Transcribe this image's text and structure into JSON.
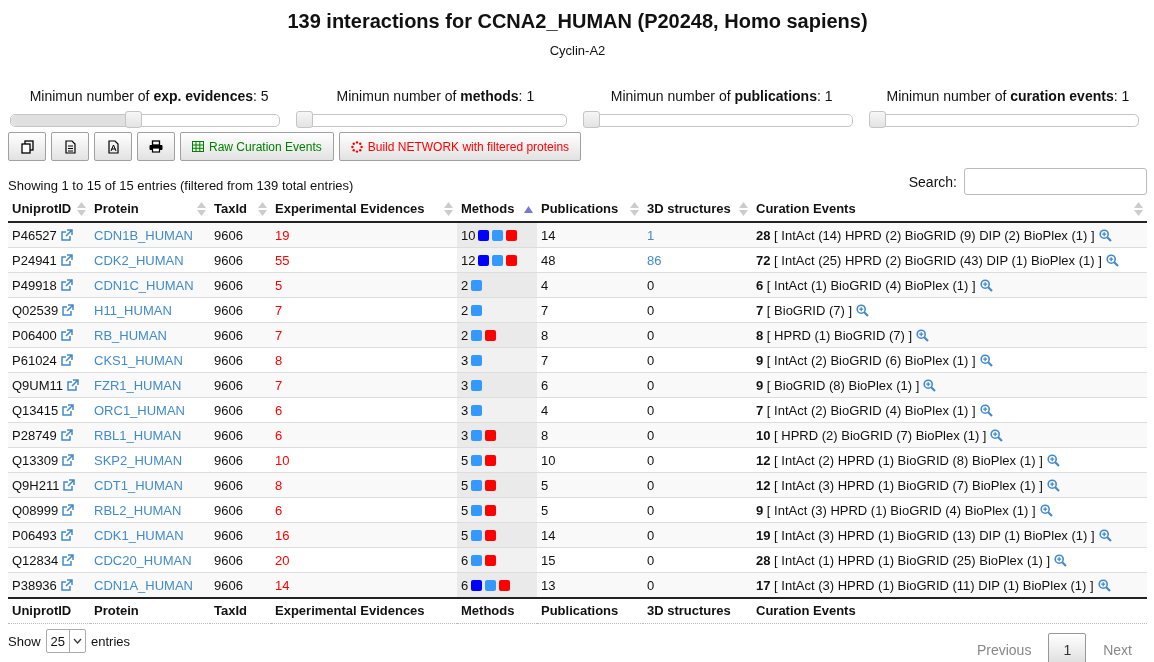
{
  "title": "139 interactions for CCNA2_HUMAN (P20248, Homo sapiens)",
  "subtitle": "Cyclin-A2",
  "sliders": [
    {
      "label": "Minimun number of **exp. evidences**: 5",
      "level": 0.43
    },
    {
      "label": "Minimun number of **methods**: 1",
      "level": 0
    },
    {
      "label": "Minimun number of **publications**: 1",
      "level": 0
    },
    {
      "label": "Minimun number of **curation events**: 1",
      "level": 0
    }
  ],
  "toolbar": [
    {
      "kind": "copy"
    },
    {
      "kind": "csv"
    },
    {
      "kind": "pdf"
    },
    {
      "kind": "print"
    },
    {
      "kind": "raw",
      "label": "Raw Curation Events"
    },
    {
      "kind": "network",
      "label": "Build NETWORK with filtered proteins"
    }
  ],
  "info": "Showing 1 to 15 of 15 entries (filtered from 139 total entries)",
  "search": {
    "label": "Search:"
  },
  "columns": [
    {
      "label": "UniprotID",
      "sorted": false
    },
    {
      "label": "Protein",
      "sorted": false
    },
    {
      "label": "TaxId",
      "sorted": false
    },
    {
      "label": "Experimental Evidences",
      "sorted": false
    },
    {
      "label": "Methods",
      "sorted": true
    },
    {
      "label": "Publications",
      "sorted": false
    },
    {
      "label": "3D structures",
      "sorted": false
    },
    {
      "label": "Curation Events",
      "sorted": false
    }
  ],
  "rows": [
    {
      "id": "P46527",
      "protein": "CDN1B_HUMAN",
      "taxid": "9606",
      "evidences": "19",
      "methods": "10",
      "method_markers": [
        {
          "color": "#0000ff"
        },
        {
          "color": "#3399ff"
        },
        {
          "color": "#ff0000"
        }
      ],
      "publications": "14",
      "structures": {
        "text": "1",
        "link": true
      },
      "curation": "**28** [ IntAct (14) HPRD (2) BioGRID (9) DIP (2) BioPlex (1) ]"
    },
    {
      "id": "P24941",
      "protein": "CDK2_HUMAN",
      "taxid": "9606",
      "evidences": "55",
      "methods": "12",
      "method_markers": [
        {
          "color": "#0000ff"
        },
        {
          "color": "#3399ff"
        },
        {
          "color": "#ff0000"
        }
      ],
      "publications": "48",
      "structures": {
        "text": "86",
        "link": true
      },
      "curation": "**72** [ IntAct (25) HPRD (2) BioGRID (43) DIP (1) BioPlex (1) ]"
    },
    {
      "id": "P49918",
      "protein": "CDN1C_HUMAN",
      "taxid": "9606",
      "evidences": "5",
      "methods": "2",
      "method_markers": [
        {
          "color": "#3399ff"
        }
      ],
      "publications": "4",
      "structures": {
        "text": "0",
        "link": false
      },
      "curation": "**6** [ IntAct (1) BioGRID (4) BioPlex (1) ]"
    },
    {
      "id": "Q02539",
      "protein": "H11_HUMAN",
      "taxid": "9606",
      "evidences": "7",
      "methods": "2",
      "method_markers": [
        {
          "color": "#3399ff"
        }
      ],
      "publications": "7",
      "structures": {
        "text": "0",
        "link": false
      },
      "curation": "**7** [ BioGRID (7) ]"
    },
    {
      "id": "P06400",
      "protein": "RB_HUMAN",
      "taxid": "9606",
      "evidences": "7",
      "methods": "2",
      "method_markers": [
        {
          "color": "#3399ff"
        },
        {
          "color": "#ff0000"
        }
      ],
      "publications": "8",
      "structures": {
        "text": "0",
        "link": false
      },
      "curation": "**8** [ HPRD (1) BioGRID (7) ]"
    },
    {
      "id": "P61024",
      "protein": "CKS1_HUMAN",
      "taxid": "9606",
      "evidences": "8",
      "methods": "3",
      "method_markers": [
        {
          "color": "#3399ff"
        }
      ],
      "publications": "7",
      "structures": {
        "text": "0",
        "link": false
      },
      "curation": "**9** [ IntAct (2) BioGRID (6) BioPlex (1) ]"
    },
    {
      "id": "Q9UM11",
      "protein": "FZR1_HUMAN",
      "taxid": "9606",
      "evidences": "7",
      "methods": "3",
      "method_markers": [
        {
          "color": "#3399ff"
        }
      ],
      "publications": "6",
      "structures": {
        "text": "0",
        "link": false
      },
      "curation": "**9** [ BioGRID (8) BioPlex (1) ]"
    },
    {
      "id": "Q13415",
      "protein": "ORC1_HUMAN",
      "taxid": "9606",
      "evidences": "6",
      "methods": "3",
      "method_markers": [
        {
          "color": "#3399ff"
        }
      ],
      "publications": "4",
      "structures": {
        "text": "0",
        "link": false
      },
      "curation": "**7** [ IntAct (2) BioGRID (4) BioPlex (1) ]"
    },
    {
      "id": "P28749",
      "protein": "RBL1_HUMAN",
      "taxid": "9606",
      "evidences": "6",
      "methods": "3",
      "method_markers": [
        {
          "color": "#3399ff"
        },
        {
          "color": "#ff0000"
        }
      ],
      "publications": "8",
      "structures": {
        "text": "0",
        "link": false
      },
      "curation": "**10** [ HPRD (2) BioGRID (7) BioPlex (1) ]"
    },
    {
      "id": "Q13309",
      "protein": "SKP2_HUMAN",
      "taxid": "9606",
      "evidences": "10",
      "methods": "5",
      "method_markers": [
        {
          "color": "#3399ff"
        },
        {
          "color": "#ff0000"
        }
      ],
      "publications": "10",
      "structures": {
        "text": "0",
        "link": false
      },
      "curation": "**12** [ IntAct (2) HPRD (1) BioGRID (8) BioPlex (1) ]"
    },
    {
      "id": "Q9H211",
      "protein": "CDT1_HUMAN",
      "taxid": "9606",
      "evidences": "8",
      "methods": "5",
      "method_markers": [
        {
          "color": "#3399ff"
        },
        {
          "color": "#ff0000"
        }
      ],
      "publications": "5",
      "structures": {
        "text": "0",
        "link": false
      },
      "curation": "**12** [ IntAct (3) HPRD (1) BioGRID (7) BioPlex (1) ]"
    },
    {
      "id": "Q08999",
      "protein": "RBL2_HUMAN",
      "taxid": "9606",
      "evidences": "6",
      "methods": "5",
      "method_markers": [
        {
          "color": "#3399ff"
        },
        {
          "color": "#ff0000"
        }
      ],
      "publications": "5",
      "structures": {
        "text": "0",
        "link": false
      },
      "curation": "**9** [ IntAct (3) HPRD (1) BioGRID (4) BioPlex (1) ]"
    },
    {
      "id": "P06493",
      "protein": "CDK1_HUMAN",
      "taxid": "9606",
      "evidences": "16",
      "methods": "5",
      "method_markers": [
        {
          "color": "#3399ff"
        },
        {
          "color": "#ff0000"
        }
      ],
      "publications": "14",
      "structures": {
        "text": "0",
        "link": false
      },
      "curation": "**19** [ IntAct (3) HPRD (1) BioGRID (13) DIP (1) BioPlex (1) ]"
    },
    {
      "id": "Q12834",
      "protein": "CDC20_HUMAN",
      "taxid": "9606",
      "evidences": "20",
      "methods": "6",
      "method_markers": [
        {
          "color": "#3399ff"
        },
        {
          "color": "#ff0000"
        }
      ],
      "publications": "15",
      "structures": {
        "text": "0",
        "link": false
      },
      "curation": "**28** [ IntAct (1) HPRD (1) BioGRID (25) BioPlex (1) ]"
    },
    {
      "id": "P38936",
      "protein": "CDN1A_HUMAN",
      "taxid": "9606",
      "evidences": "14",
      "methods": "6",
      "method_markers": [
        {
          "color": "#0000ff"
        },
        {
          "color": "#3399ff"
        },
        {
          "color": "#ff0000"
        }
      ],
      "publications": "13",
      "structures": {
        "text": "0",
        "link": false
      },
      "curation": "**17** [ IntAct (3) HPRD (1) BioGRID (11) DIP (1) BioPlex (1) ]"
    }
  ],
  "footer_columns": [
    "UniprotID",
    "Protein",
    "TaxId",
    "Experimental Evidences",
    "Methods",
    "Publications",
    "3D structures",
    "Curation Events"
  ],
  "length": {
    "before": "Show",
    "value": "25",
    "after": "entries"
  },
  "pagination": [
    {
      "label": "Previous",
      "disabled": true,
      "selected": false
    },
    {
      "label": "1",
      "disabled": false,
      "selected": true
    },
    {
      "label": "Next",
      "disabled": true,
      "selected": false
    }
  ]
}
